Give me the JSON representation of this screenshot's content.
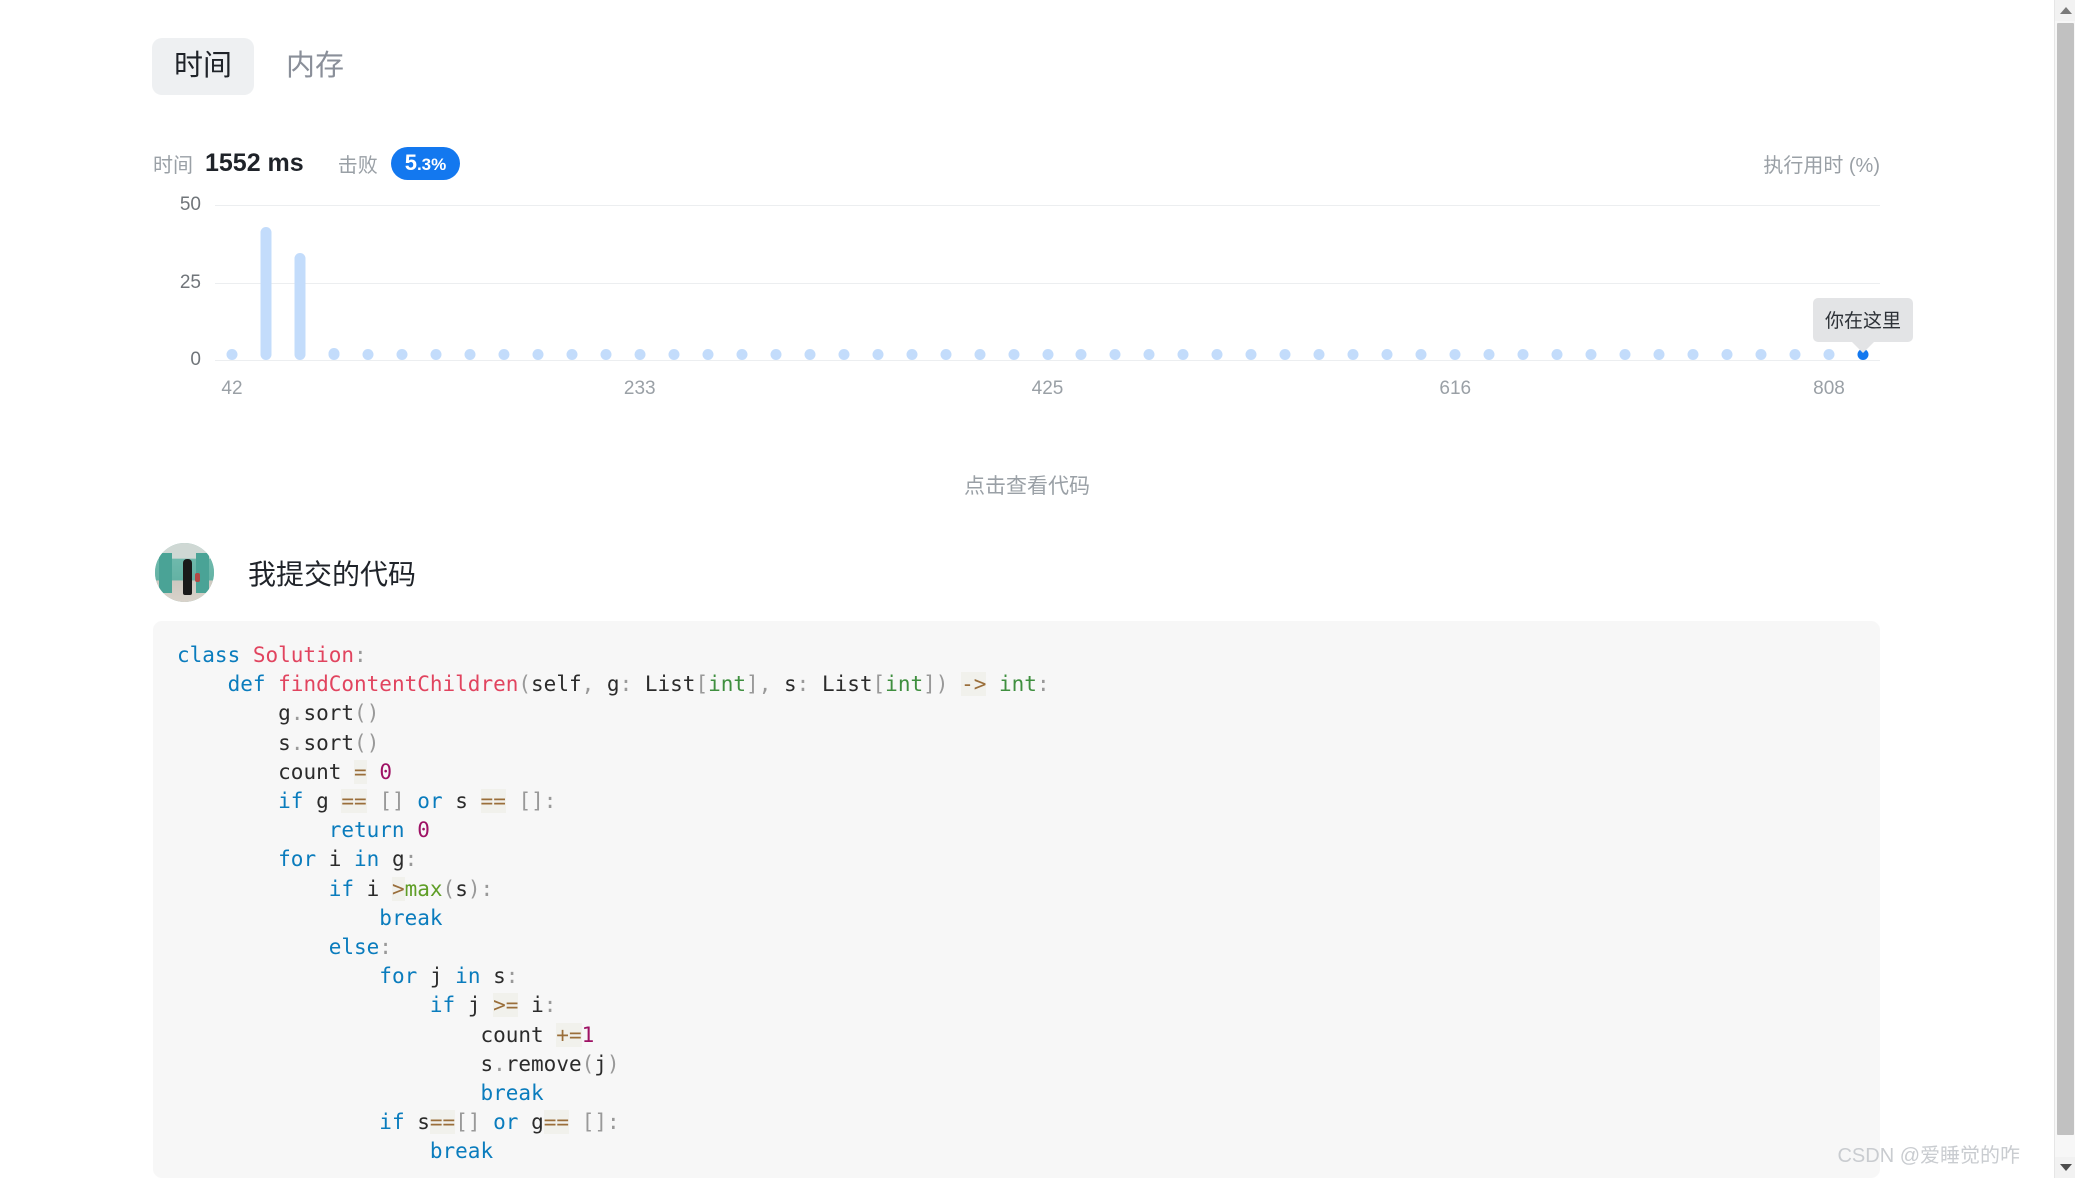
{
  "tabs": [
    {
      "label": "时间",
      "active": true
    },
    {
      "label": "内存",
      "active": false
    }
  ],
  "stats": {
    "metric_label": "时间",
    "metric_value": "1552 ms",
    "beat_label": "击败",
    "beat_value": "5.3%",
    "beat_value_major": "5",
    "beat_value_minor": ".3%",
    "axis_title": "执行用时 (%)",
    "badge_color": "#1378ef"
  },
  "view_code_link": "点击查看代码",
  "submitted": {
    "heading": "我提交的代码",
    "avatar_alt": "user-avatar"
  },
  "watermark": "CSDN @爱睡觉的咋",
  "chart_data": {
    "type": "bar",
    "title": "",
    "subtitle": "",
    "xlabel": "",
    "ylabel": "执行用时 (%)",
    "ylim": [
      0,
      50
    ],
    "yticks": [
      0,
      25,
      50
    ],
    "ytick_labels": [
      "0",
      "25",
      "50"
    ],
    "grid": true,
    "legend": false,
    "xtick_labels": [
      "42",
      "233",
      "425",
      "616",
      "808"
    ],
    "xtick_values": [
      42,
      233,
      425,
      616,
      808
    ],
    "xlim": [
      0,
      49
    ],
    "highlight_index": 48,
    "highlight_label": "你在这里",
    "bar_color": "#c3dcfb",
    "highlight_color": "#1378ef",
    "categories": [
      "0",
      "1",
      "2",
      "3",
      "4",
      "5",
      "6",
      "7",
      "8",
      "9",
      "10",
      "11",
      "12",
      "13",
      "14",
      "15",
      "16",
      "17",
      "18",
      "19",
      "20",
      "21",
      "22",
      "23",
      "24",
      "25",
      "26",
      "27",
      "28",
      "29",
      "30",
      "31",
      "32",
      "33",
      "34",
      "35",
      "36",
      "37",
      "38",
      "39",
      "40",
      "41",
      "42",
      "43",
      "44",
      "45",
      "46",
      "47",
      "48"
    ],
    "values": [
      0.6,
      43.0,
      34.5,
      4.0,
      0.6,
      0.6,
      0.6,
      0.6,
      0.6,
      0.6,
      0.6,
      0.6,
      0.6,
      0.6,
      0.6,
      0.6,
      0.6,
      0.6,
      0.6,
      0.6,
      0.6,
      0.6,
      0.6,
      0.6,
      0.6,
      0.6,
      0.6,
      0.6,
      0.6,
      0.6,
      0.6,
      0.6,
      0.6,
      0.6,
      0.6,
      0.6,
      0.6,
      0.6,
      0.6,
      0.6,
      0.6,
      0.6,
      0.6,
      0.6,
      0.6,
      0.6,
      0.6,
      0.6,
      0.6
    ]
  },
  "code": {
    "language": "python",
    "lines": [
      [
        [
          "class ",
          "k"
        ],
        [
          "Solution",
          "kn"
        ],
        [
          ":",
          "pn"
        ]
      ],
      [
        [
          "    ",
          "df"
        ],
        [
          "def ",
          "k"
        ],
        [
          "findContentChildren",
          "kn"
        ],
        [
          "(",
          "pn"
        ],
        [
          "self",
          "df"
        ],
        [
          ", ",
          "pn"
        ],
        [
          "g",
          "df"
        ],
        [
          ": ",
          "pn"
        ],
        [
          "List",
          "df"
        ],
        [
          "[",
          "pn"
        ],
        [
          "int",
          "ty"
        ],
        [
          "]",
          "pn"
        ],
        [
          ", ",
          "pn"
        ],
        [
          "s",
          "df"
        ],
        [
          ": ",
          "pn"
        ],
        [
          "List",
          "df"
        ],
        [
          "[",
          "pn"
        ],
        [
          "int",
          "ty"
        ],
        [
          "])",
          "pn"
        ],
        [
          " ",
          "df"
        ],
        [
          "->",
          "op"
        ],
        [
          " ",
          "df"
        ],
        [
          "int",
          "ty"
        ],
        [
          ":",
          "pn"
        ]
      ],
      [
        [
          "        ",
          "df"
        ],
        [
          "g",
          "df"
        ],
        [
          ".",
          "pn"
        ],
        [
          "sort",
          "df"
        ],
        [
          "()",
          "pn"
        ]
      ],
      [
        [
          "        ",
          "df"
        ],
        [
          "s",
          "df"
        ],
        [
          ".",
          "pn"
        ],
        [
          "sort",
          "df"
        ],
        [
          "()",
          "pn"
        ]
      ],
      [
        [
          "        ",
          "df"
        ],
        [
          "count ",
          "df"
        ],
        [
          "=",
          "op"
        ],
        [
          " ",
          "df"
        ],
        [
          "0",
          "nu"
        ]
      ],
      [
        [
          "        ",
          "df"
        ],
        [
          "if ",
          "k"
        ],
        [
          "g ",
          "df"
        ],
        [
          "==",
          "op"
        ],
        [
          " ",
          "df"
        ],
        [
          "[]",
          "pn"
        ],
        [
          " ",
          "df"
        ],
        [
          "or",
          "k"
        ],
        [
          " ",
          "df"
        ],
        [
          "s ",
          "df"
        ],
        [
          "==",
          "op"
        ],
        [
          " ",
          "df"
        ],
        [
          "[]",
          "pn"
        ],
        [
          ":",
          "pn"
        ]
      ],
      [
        [
          "            ",
          "df"
        ],
        [
          "return ",
          "k"
        ],
        [
          "0",
          "nu"
        ]
      ],
      [
        [
          "        ",
          "df"
        ],
        [
          "for ",
          "k"
        ],
        [
          "i ",
          "df"
        ],
        [
          "in ",
          "k"
        ],
        [
          "g",
          "df"
        ],
        [
          ":",
          "pn"
        ]
      ],
      [
        [
          "            ",
          "df"
        ],
        [
          "if ",
          "k"
        ],
        [
          "i ",
          "df"
        ],
        [
          ">",
          "op"
        ],
        [
          "max",
          "bi"
        ],
        [
          "(",
          "pn"
        ],
        [
          "s",
          "df"
        ],
        [
          ")",
          "pn"
        ],
        [
          ":",
          "pn"
        ]
      ],
      [
        [
          "                ",
          "df"
        ],
        [
          "break",
          "k"
        ]
      ],
      [
        [
          "            ",
          "df"
        ],
        [
          "else",
          "k"
        ],
        [
          ":",
          "pn"
        ]
      ],
      [
        [
          "                ",
          "df"
        ],
        [
          "for ",
          "k"
        ],
        [
          "j ",
          "df"
        ],
        [
          "in ",
          "k"
        ],
        [
          "s",
          "df"
        ],
        [
          ":",
          "pn"
        ]
      ],
      [
        [
          "                    ",
          "df"
        ],
        [
          "if ",
          "k"
        ],
        [
          "j ",
          "df"
        ],
        [
          ">=",
          "op"
        ],
        [
          " ",
          "df"
        ],
        [
          "i",
          "df"
        ],
        [
          ":",
          "pn"
        ]
      ],
      [
        [
          "                        ",
          "df"
        ],
        [
          "count ",
          "df"
        ],
        [
          "+=",
          "op"
        ],
        [
          "1",
          "nu"
        ]
      ],
      [
        [
          "                        ",
          "df"
        ],
        [
          "s",
          "df"
        ],
        [
          ".",
          "pn"
        ],
        [
          "remove",
          "df"
        ],
        [
          "(",
          "pn"
        ],
        [
          "j",
          "df"
        ],
        [
          ")",
          "pn"
        ]
      ],
      [
        [
          "                        ",
          "df"
        ],
        [
          "break",
          "k"
        ]
      ],
      [
        [
          "                ",
          "df"
        ],
        [
          "if ",
          "k"
        ],
        [
          "s",
          "df"
        ],
        [
          "==",
          "op"
        ],
        [
          "[]",
          "pn"
        ],
        [
          " ",
          "df"
        ],
        [
          "or",
          "k"
        ],
        [
          " ",
          "df"
        ],
        [
          "g",
          "df"
        ],
        [
          "==",
          "op"
        ],
        [
          " ",
          "df"
        ],
        [
          "[]",
          "pn"
        ],
        [
          ":",
          "pn"
        ]
      ],
      [
        [
          "                    ",
          "df"
        ],
        [
          "break",
          "k"
        ]
      ]
    ]
  },
  "scrollbar": {
    "up_arrow": "scroll-up-arrow",
    "down_arrow": "scroll-down-arrow"
  }
}
